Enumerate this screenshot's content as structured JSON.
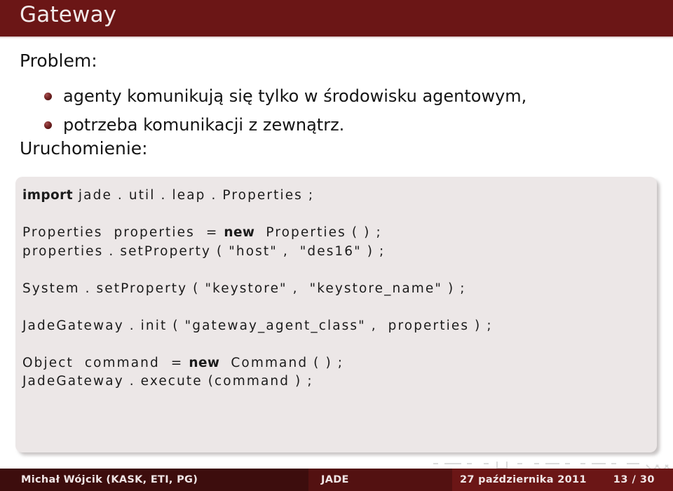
{
  "header": {
    "title": "Gateway"
  },
  "body": {
    "problem_heading": "Problem:",
    "bullets": [
      "agenty komunikują się tylko w środowisku agentowym,",
      "potrzeba komunikacji z zewnątrz."
    ],
    "uruchomienie_heading": "Uruchomienie:"
  },
  "code": {
    "lines": [
      {
        "segments": [
          {
            "text": "import",
            "bold": true
          },
          {
            "text": " jade . util . leap . Properties ;",
            "bold": false
          }
        ]
      },
      {
        "segments": [
          {
            "text": "",
            "bold": false
          }
        ]
      },
      {
        "segments": [
          {
            "text": "Properties  properties  = ",
            "bold": false
          },
          {
            "text": "new",
            "bold": true
          },
          {
            "text": "  Properties ( ) ;",
            "bold": false
          }
        ]
      },
      {
        "segments": [
          {
            "text": "properties . setProperty ( \"host\" ,  \"des16\" ) ;",
            "bold": false
          }
        ]
      },
      {
        "segments": [
          {
            "text": "",
            "bold": false
          }
        ]
      },
      {
        "segments": [
          {
            "text": "System . setProperty ( \"keystore\" ,  \"keystore_name\" ) ;",
            "bold": false
          }
        ]
      },
      {
        "segments": [
          {
            "text": "",
            "bold": false
          }
        ]
      },
      {
        "segments": [
          {
            "text": "JadeGateway . init ( \"gateway_agent_class\" ,  properties ) ;",
            "bold": false
          }
        ]
      },
      {
        "segments": [
          {
            "text": "",
            "bold": false
          }
        ]
      },
      {
        "segments": [
          {
            "text": "Object  command  = ",
            "bold": false
          },
          {
            "text": "new",
            "bold": true
          },
          {
            "text": "  Command ( ) ;",
            "bold": false
          }
        ]
      },
      {
        "segments": [
          {
            "text": "JadeGateway . execute (command ) ;",
            "bold": false
          }
        ]
      }
    ]
  },
  "footer": {
    "author": "Michał Wójcik  (KASK, ETI, PG)",
    "section": "JADE",
    "date": "27 października 2011",
    "page": "13 / 30"
  },
  "colors": {
    "header_bar": "#6b1616",
    "footer_dark": "#3d0d0d",
    "footer_mid": "#531111",
    "footer_light": "#6b1616",
    "code_background": "#ece7e7",
    "bullet": "#7d2a2a",
    "text": "#141414"
  }
}
